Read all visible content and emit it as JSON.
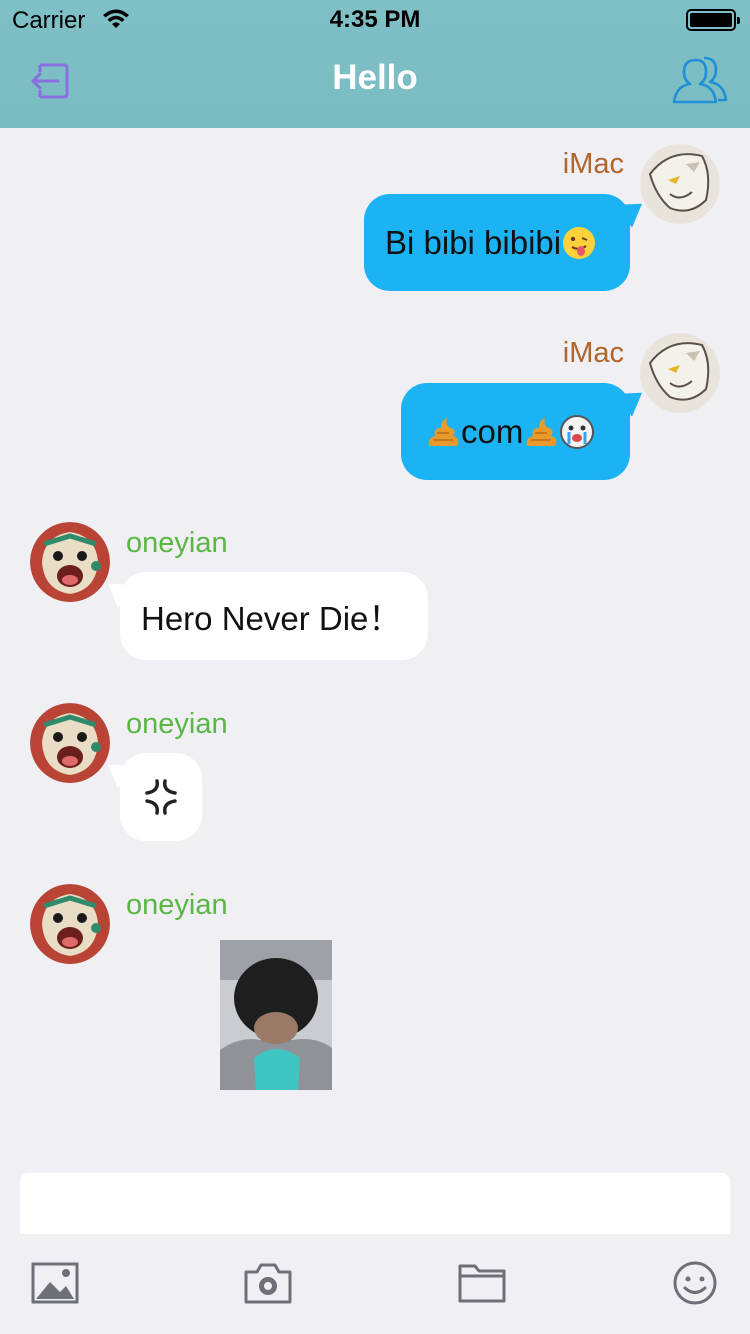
{
  "status_bar": {
    "carrier": "Carrier",
    "time": "4:35 PM"
  },
  "nav": {
    "title": "Hello",
    "left_icon": "logout-icon",
    "right_icon": "contacts-icon"
  },
  "messages": [
    {
      "sender": "iMac",
      "side": "right",
      "text": "Bi bibi bibibi",
      "emojis": [
        "tongue-face-emoji"
      ]
    },
    {
      "sender": "iMac",
      "side": "right",
      "text": "com",
      "emojis": [
        "poop-emoji",
        "poop-emoji",
        "crying-face-emoji"
      ]
    },
    {
      "sender": "oneyian",
      "side": "left",
      "text": "Hero Never Die！"
    },
    {
      "sender": "oneyian",
      "side": "left",
      "sticker": "anger-symbol-emoji"
    },
    {
      "sender": "oneyian",
      "side": "left",
      "image": "photo-of-person"
    }
  ],
  "input": {
    "placeholder": ""
  },
  "toolbar": {
    "icons": [
      "photo-library-icon",
      "camera-icon",
      "folder-icon",
      "emoji-icon"
    ]
  },
  "colors": {
    "nav_bg": "#7fc0c6",
    "bubble_me": "#1bb3f3",
    "bubble_other": "#ffffff",
    "name_me": "#b0652a",
    "name_other": "#5ab645",
    "background": "#efeff4"
  }
}
